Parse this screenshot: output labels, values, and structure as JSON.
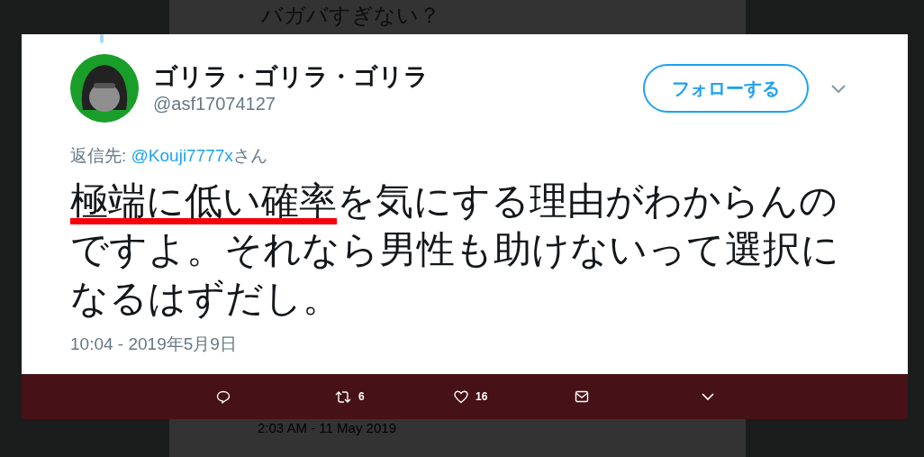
{
  "background_tweet": {
    "text": "バガバすぎない？",
    "timestamp": "2:03 AM - 11 May 2019"
  },
  "tweet": {
    "display_name": "ゴリラ・ゴリラ・ゴリラ",
    "handle": "@asf17074127",
    "follow_button": "フォローする",
    "reply_to": {
      "label": "返信先: ",
      "mention": "@Kouji7777x",
      "suffix": "さん"
    },
    "text_segments": [
      {
        "text": "極端に低い確率",
        "underlined": true
      },
      {
        "text": "を気にする理由がわからんのですよ。それなら男性も助けないって選択になるはずだし。",
        "underlined": false
      }
    ],
    "timestamp": "10:04 - 2019年5月9日"
  },
  "actions": [
    {
      "kind": "reply"
    },
    {
      "kind": "retweet",
      "count": "6"
    },
    {
      "kind": "like",
      "count": "16"
    },
    {
      "kind": "message"
    },
    {
      "kind": "more"
    }
  ]
}
